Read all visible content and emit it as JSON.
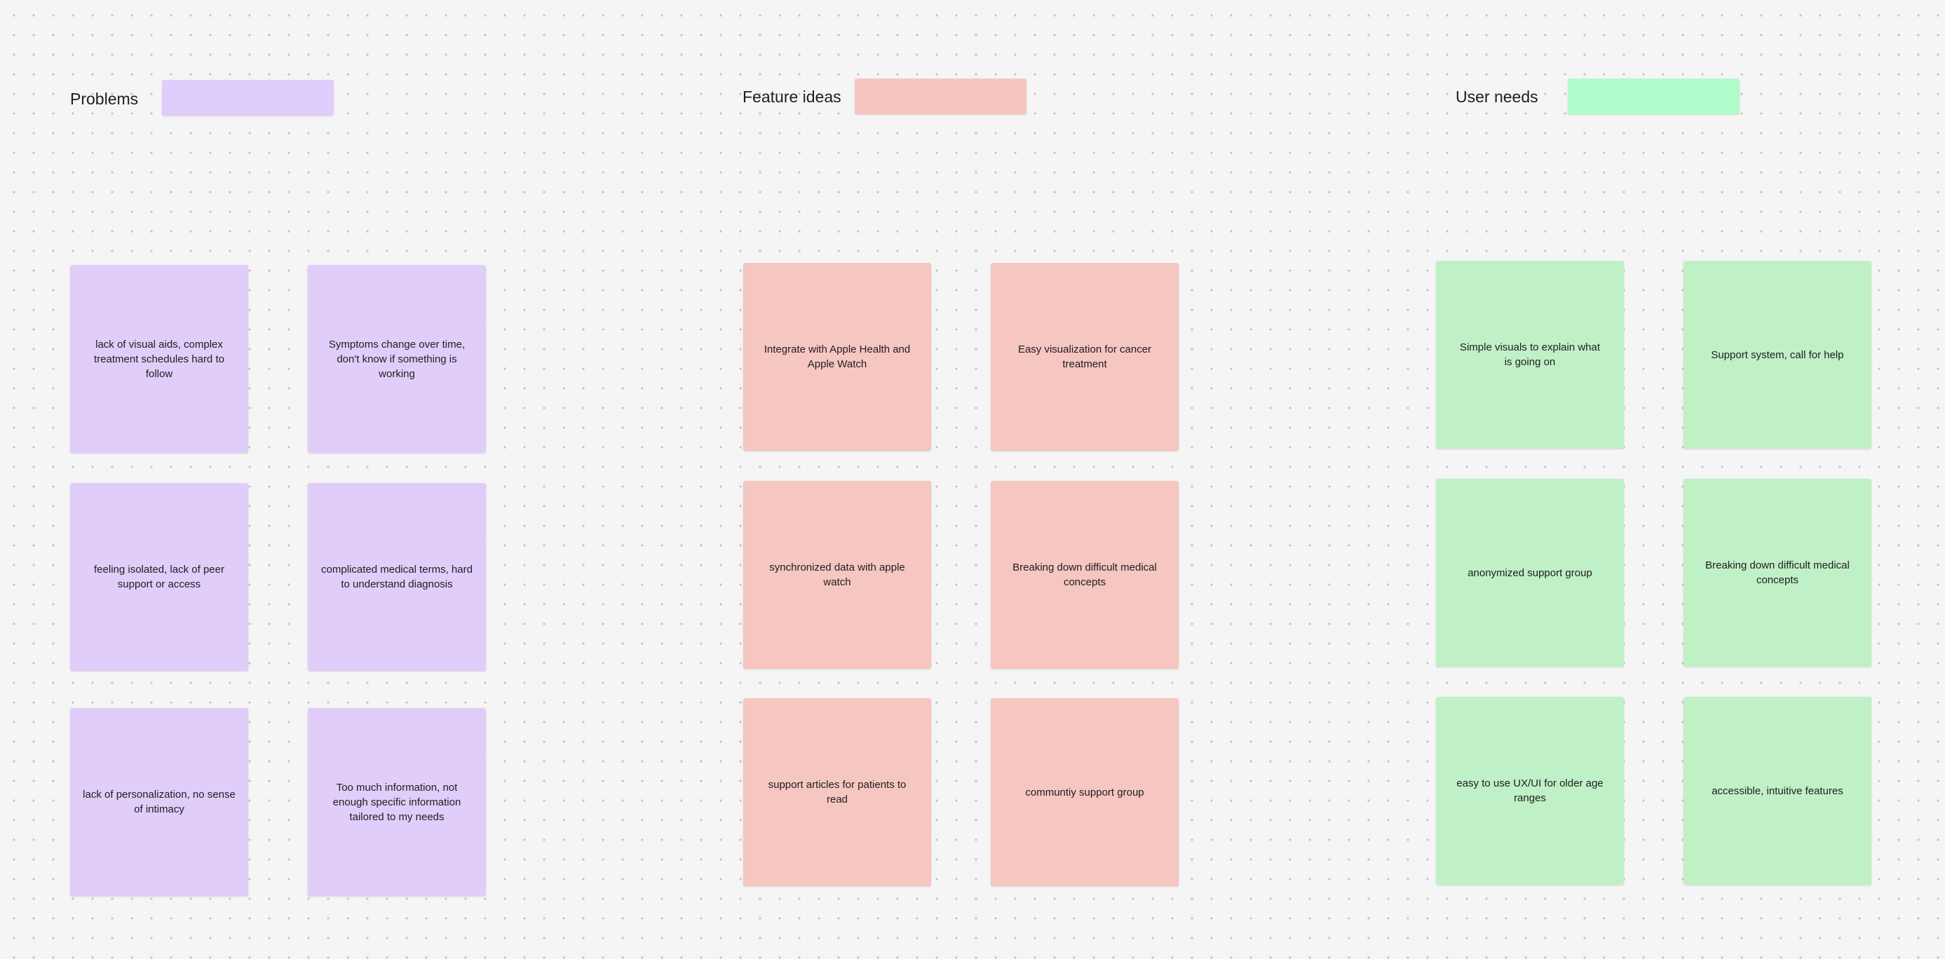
{
  "colors": {
    "background": "#f5f5f5",
    "problems_swatch": "#dfcdfb",
    "problems_note": "#e0cdfa",
    "features_swatch": "#f6c5c0",
    "features_note": "#f6c6c1",
    "needs_swatch": "#b0fbca",
    "needs_note": "#c0f0c6"
  },
  "sections": {
    "problems": {
      "title": "Problems",
      "notes": [
        "lack of visual aids, complex treatment schedules hard to follow",
        "Symptoms change over time, don't know if something is working",
        "feeling isolated, lack of peer support or access",
        "complicated medical terms, hard to understand diagnosis",
        "lack of personalization, no sense of intimacy",
        "Too much information, not enough specific information tailored to my needs"
      ]
    },
    "features": {
      "title": "Feature ideas",
      "notes": [
        "Integrate with Apple Health and Apple Watch",
        "Easy visualization for cancer treatment",
        "synchronized data with apple watch",
        "Breaking down difficult medical concepts",
        "support articles for patients to read",
        "communtiy support group"
      ]
    },
    "needs": {
      "title": "User needs",
      "notes": [
        "Simple visuals to explain what is going on",
        "Support system, call for help",
        "anonymized support group",
        "Breaking down difficult medical concepts",
        "easy to use UX/UI for older age ranges",
        "accessible, intuitive features"
      ]
    }
  }
}
